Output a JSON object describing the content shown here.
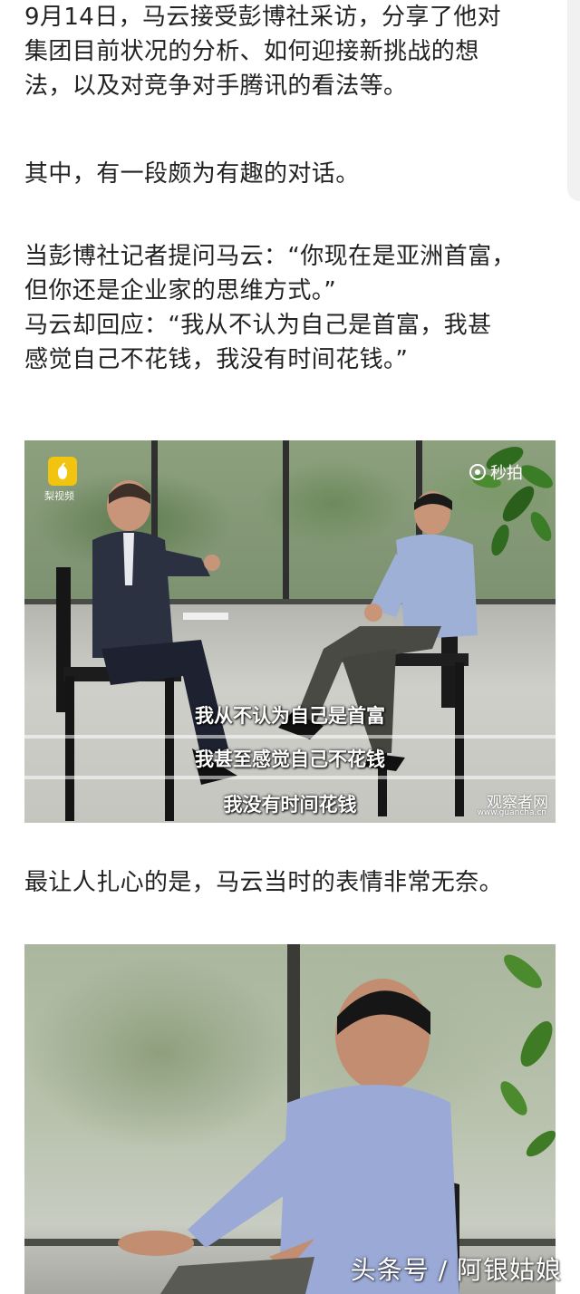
{
  "article": {
    "paragraph1": [
      "9月14日，马云接受彭博社采访，分享了他对",
      "集团目前状况的分析、如何迎接新挑战的想",
      "法，以及对竞争对手腾讯的看法等。"
    ],
    "paragraph2": "其中，有一段颇为有趣的对话。",
    "paragraph3": [
      "当彭博社记者提问马云：“你现在是亚洲首富，",
      "但你还是企业家的思维方式。”",
      "马云却回应：“我从不认为自己是首富，我甚",
      "感觉自己不花钱，我没有时间花钱。”"
    ],
    "paragraph4": "最让人扎心的是，马云当时的表情非常无奈。"
  },
  "image1": {
    "source_logo_text": "梨视频",
    "platform_watermark": "秒拍",
    "subtitles": [
      "我从不认为自己是首富",
      "我甚至感觉自己不花钱",
      "我没有时间花钱"
    ],
    "site_watermark": "观察者网",
    "site_url": "www.guancha.cn"
  },
  "image2": {
    "watermark": "头条号 / 阿银姑娘"
  },
  "colors": {
    "text": "#222222",
    "background": "#ffffff",
    "logo_yellow": "#f2c40f"
  }
}
